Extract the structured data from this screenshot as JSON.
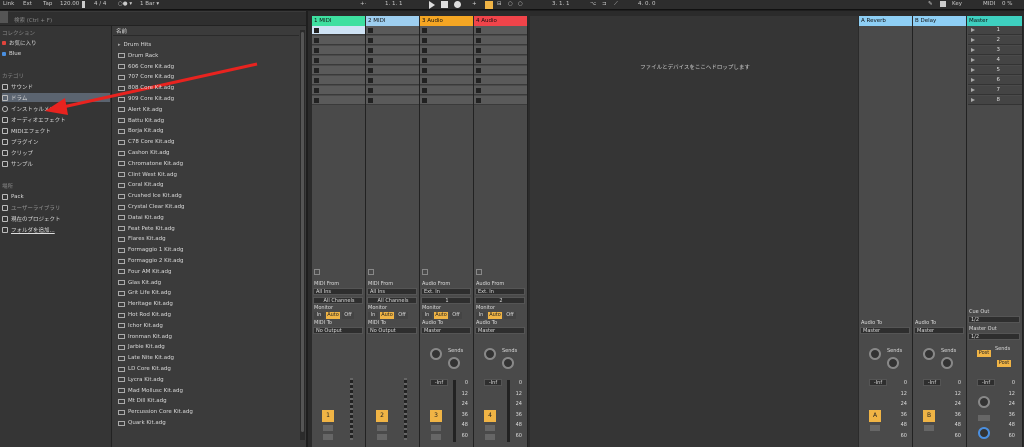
{
  "topbar": {
    "link": "Link",
    "ext": "Ext",
    "tap": "Tap",
    "tempo": "120.00",
    "sig": "4 / 4",
    "metro": "○● ▾",
    "quant": "1 Bar ▾",
    "pos": "1.  1.  1",
    "loop": "3.  1.  1",
    "len": "4.  0.  0",
    "key": "Key",
    "midi": "MIDI",
    "cpu": "0 %"
  },
  "search": {
    "placeholder": "検索 (Ctrl + F)"
  },
  "collections": {
    "label": "コレクション",
    "items": [
      {
        "label": "お気に入り",
        "color": "#e0443c"
      },
      {
        "label": "Blue",
        "color": "#4a8fe0"
      }
    ]
  },
  "categories": {
    "label": "カテゴリ",
    "items": [
      {
        "label": "サウンド",
        "icon": "sound-icon"
      },
      {
        "label": "ドラム",
        "icon": "drum-icon",
        "selected": true
      },
      {
        "label": "インストゥルメント",
        "icon": "instrument-icon"
      },
      {
        "label": "オーディオエフェクト",
        "icon": "audio-effect-icon"
      },
      {
        "label": "MIDIエフェクト",
        "icon": "midi-effect-icon"
      },
      {
        "label": "プラグイン",
        "icon": "plugin-icon"
      },
      {
        "label": "クリップ",
        "icon": "clip-icon"
      },
      {
        "label": "サンプル",
        "icon": "sample-icon"
      }
    ]
  },
  "places": {
    "label": "場所",
    "items": [
      {
        "label": "Pack",
        "icon": "pack-icon"
      },
      {
        "label": "ユーザーライブラリ",
        "icon": "user-library-icon"
      },
      {
        "label": "現在のプロジェクト",
        "icon": "project-icon"
      },
      {
        "label": "フォルダを追加...",
        "icon": "add-folder-icon"
      }
    ]
  },
  "filelist": {
    "header": "名前",
    "items": [
      "Drum Hits",
      "Drum Rack",
      "606 Core Kit.adg",
      "707 Core Kit.adg",
      "808 Core Kit.adg",
      "909 Core Kit.adg",
      "Alert Kit.adg",
      "Battu Kit.adg",
      "Borja Kit.adg",
      "C78 Core Kit.adg",
      "Cashon Kit.adg",
      "Chromatone Kit.adg",
      "Clint West Kit.adg",
      "Coral Kit.adg",
      "Crushed Ice Kit.adg",
      "Crystal Clear Kit.adg",
      "Datai Kit.adg",
      "Feat Pete Kit.adg",
      "Flares Kit.adg",
      "Formaggio 1 Kit.adg",
      "Formaggio 2 Kit.adg",
      "Four AM Kit.adg",
      "Glas Kit.adg",
      "Grit Life Kit.adg",
      "Heritage Kit.adg",
      "Hot Rod Kit.adg",
      "Ichor Kit.adg",
      "Ironman Kit.adg",
      "Jarbie Kit.adg",
      "Late Nite Kit.adg",
      "LD Core Kit.adg",
      "Lycra Kit.adg",
      "Mad Mollusc Kit.adg",
      "Mt Dill Kit.adg",
      "Percussion Core Kit.adg",
      "Quark Kit.adg"
    ]
  },
  "tracks": [
    {
      "name": "1 MIDI",
      "color": "#3ee0a0",
      "type": "midi",
      "num": "1"
    },
    {
      "name": "2 MIDI",
      "color": "#9ecff0",
      "type": "midi",
      "num": "2"
    },
    {
      "name": "3 Audio",
      "color": "#f5a623",
      "type": "audio",
      "num": "3",
      "ch": "1"
    },
    {
      "name": "4 Audio",
      "color": "#f0444a",
      "type": "audio",
      "num": "4",
      "ch": "2"
    }
  ],
  "returns": [
    {
      "name": "A Reverb",
      "color": "#8ecff5",
      "letter": "A"
    },
    {
      "name": "B Delay",
      "color": "#8ecff5",
      "letter": "B"
    }
  ],
  "master": {
    "name": "Master",
    "color": "#3ed0c0",
    "scenes": [
      "1",
      "2",
      "3",
      "4",
      "5",
      "6",
      "7",
      "8"
    ],
    "cue_out": "Cue Out",
    "cue_val": "1/2",
    "master_out": "Master Out",
    "master_val": "1/2",
    "post": "Post"
  },
  "io": {
    "midi_from": "MIDI From",
    "all_ins": "All Ins",
    "all_channels": "All Channels",
    "monitor": "Monitor",
    "in": "In",
    "auto": "Auto",
    "off": "Off",
    "midi_to": "MIDI To",
    "no_output": "No Output",
    "audio_from": "Audio From",
    "ext_in": "Ext. In",
    "audio_to": "Audio To",
    "master": "Master",
    "sends": "Sends",
    "inf": "-Inf",
    "scale": [
      "0",
      "12",
      "24",
      "36",
      "48",
      "60"
    ]
  },
  "drop_text": "ファイルとデバイスをここへドロップします"
}
